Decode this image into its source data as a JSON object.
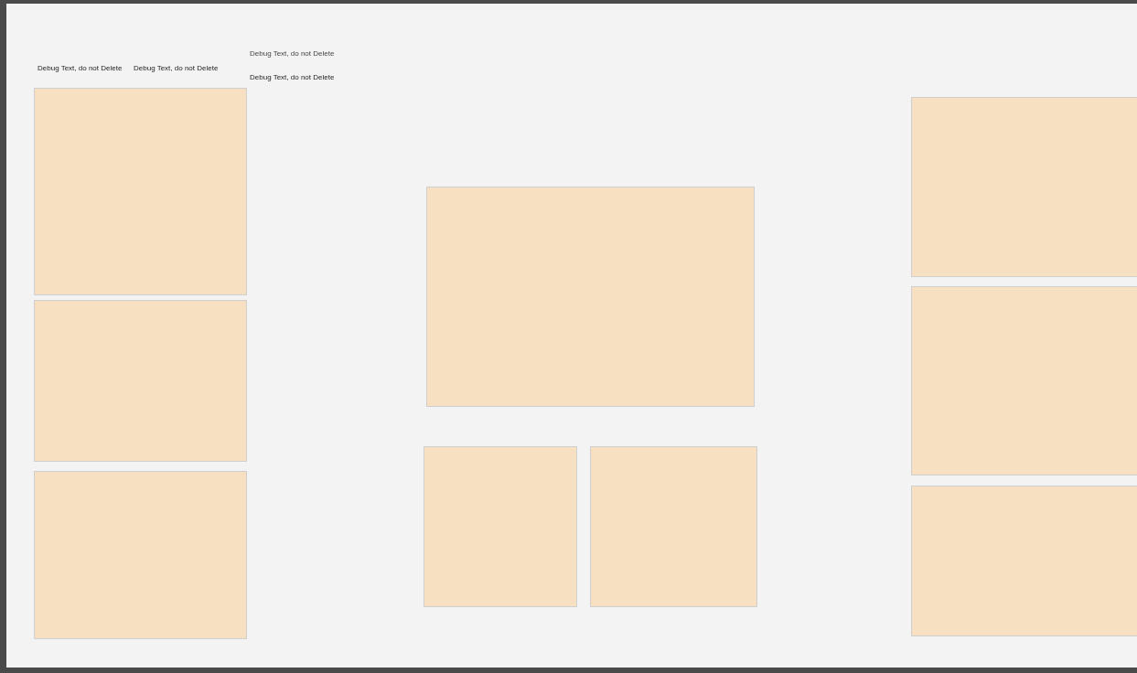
{
  "debug_texts": [
    {
      "text": "Debug Text, do not Delete"
    },
    {
      "text": "Debug Text, do not Delete"
    },
    {
      "text": "Debug Text, do not Delete"
    },
    {
      "text": "Debug Text, do not Delete"
    }
  ],
  "left_column": {
    "panels": [
      {
        "kind": "panel"
      },
      {
        "kind": "panel"
      },
      {
        "kind": "panel"
      }
    ]
  },
  "center_column": {
    "panels": [
      {
        "kind": "panel"
      },
      {
        "kind": "panel"
      },
      {
        "kind": "panel"
      }
    ]
  },
  "right_column": {
    "panels": [
      {
        "kind": "panel"
      },
      {
        "kind": "panel"
      },
      {
        "kind": "panel"
      }
    ]
  }
}
